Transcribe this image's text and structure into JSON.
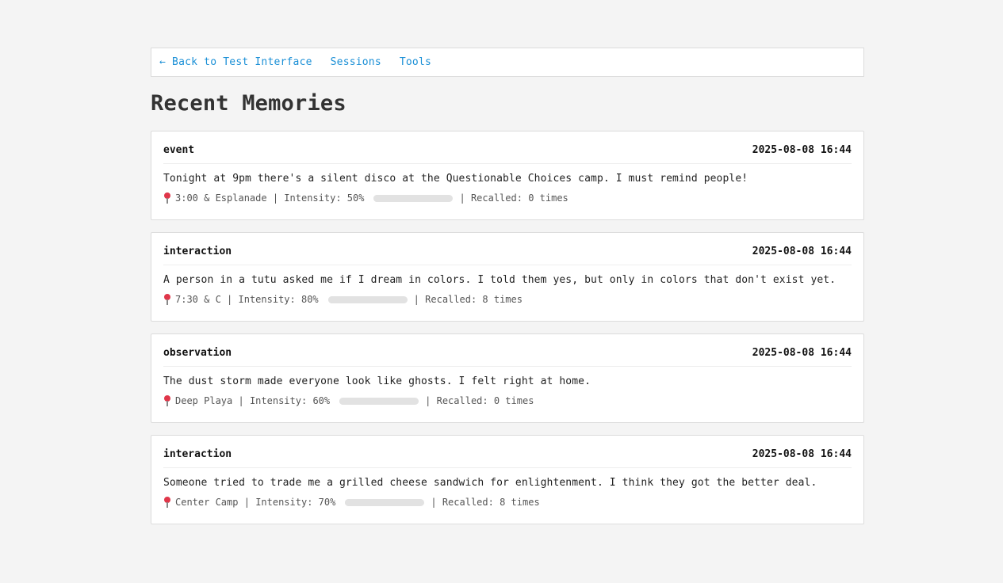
{
  "nav": {
    "back_label": "← Back to Test Interface",
    "sessions_label": "Sessions",
    "tools_label": "Tools"
  },
  "page": {
    "title": "Recent Memories"
  },
  "labels": {
    "intensity_prefix": "Intensity:",
    "recalled_prefix": "Recalled:",
    "separator": "|"
  },
  "memories": [
    {
      "type": "event",
      "timestamp": "2025-08-08 16:44",
      "text": "Tonight at 9pm there's a silent disco at the Questionable Choices camp. I must remind people!",
      "location": "3:00 & Esplanade",
      "intensity": "50%",
      "intensity_value": 0.5,
      "recalled": "0 times"
    },
    {
      "type": "interaction",
      "timestamp": "2025-08-08 16:44",
      "text": "A person in a tutu asked me if I dream in colors. I told them yes, but only in colors that don't exist yet.",
      "location": "7:30 & C",
      "intensity": "80%",
      "intensity_value": 0.8,
      "recalled": "8 times"
    },
    {
      "type": "observation",
      "timestamp": "2025-08-08 16:44",
      "text": "The dust storm made everyone look like ghosts. I felt right at home.",
      "location": "Deep Playa",
      "intensity": "60%",
      "intensity_value": 0.6,
      "recalled": "0 times"
    },
    {
      "type": "interaction",
      "timestamp": "2025-08-08 16:44",
      "text": "Someone tried to trade me a grilled cheese sandwich for enlightenment. I think they got the better deal.",
      "location": "Center Camp",
      "intensity": "70%",
      "intensity_value": 0.7,
      "recalled": "8 times"
    }
  ]
}
